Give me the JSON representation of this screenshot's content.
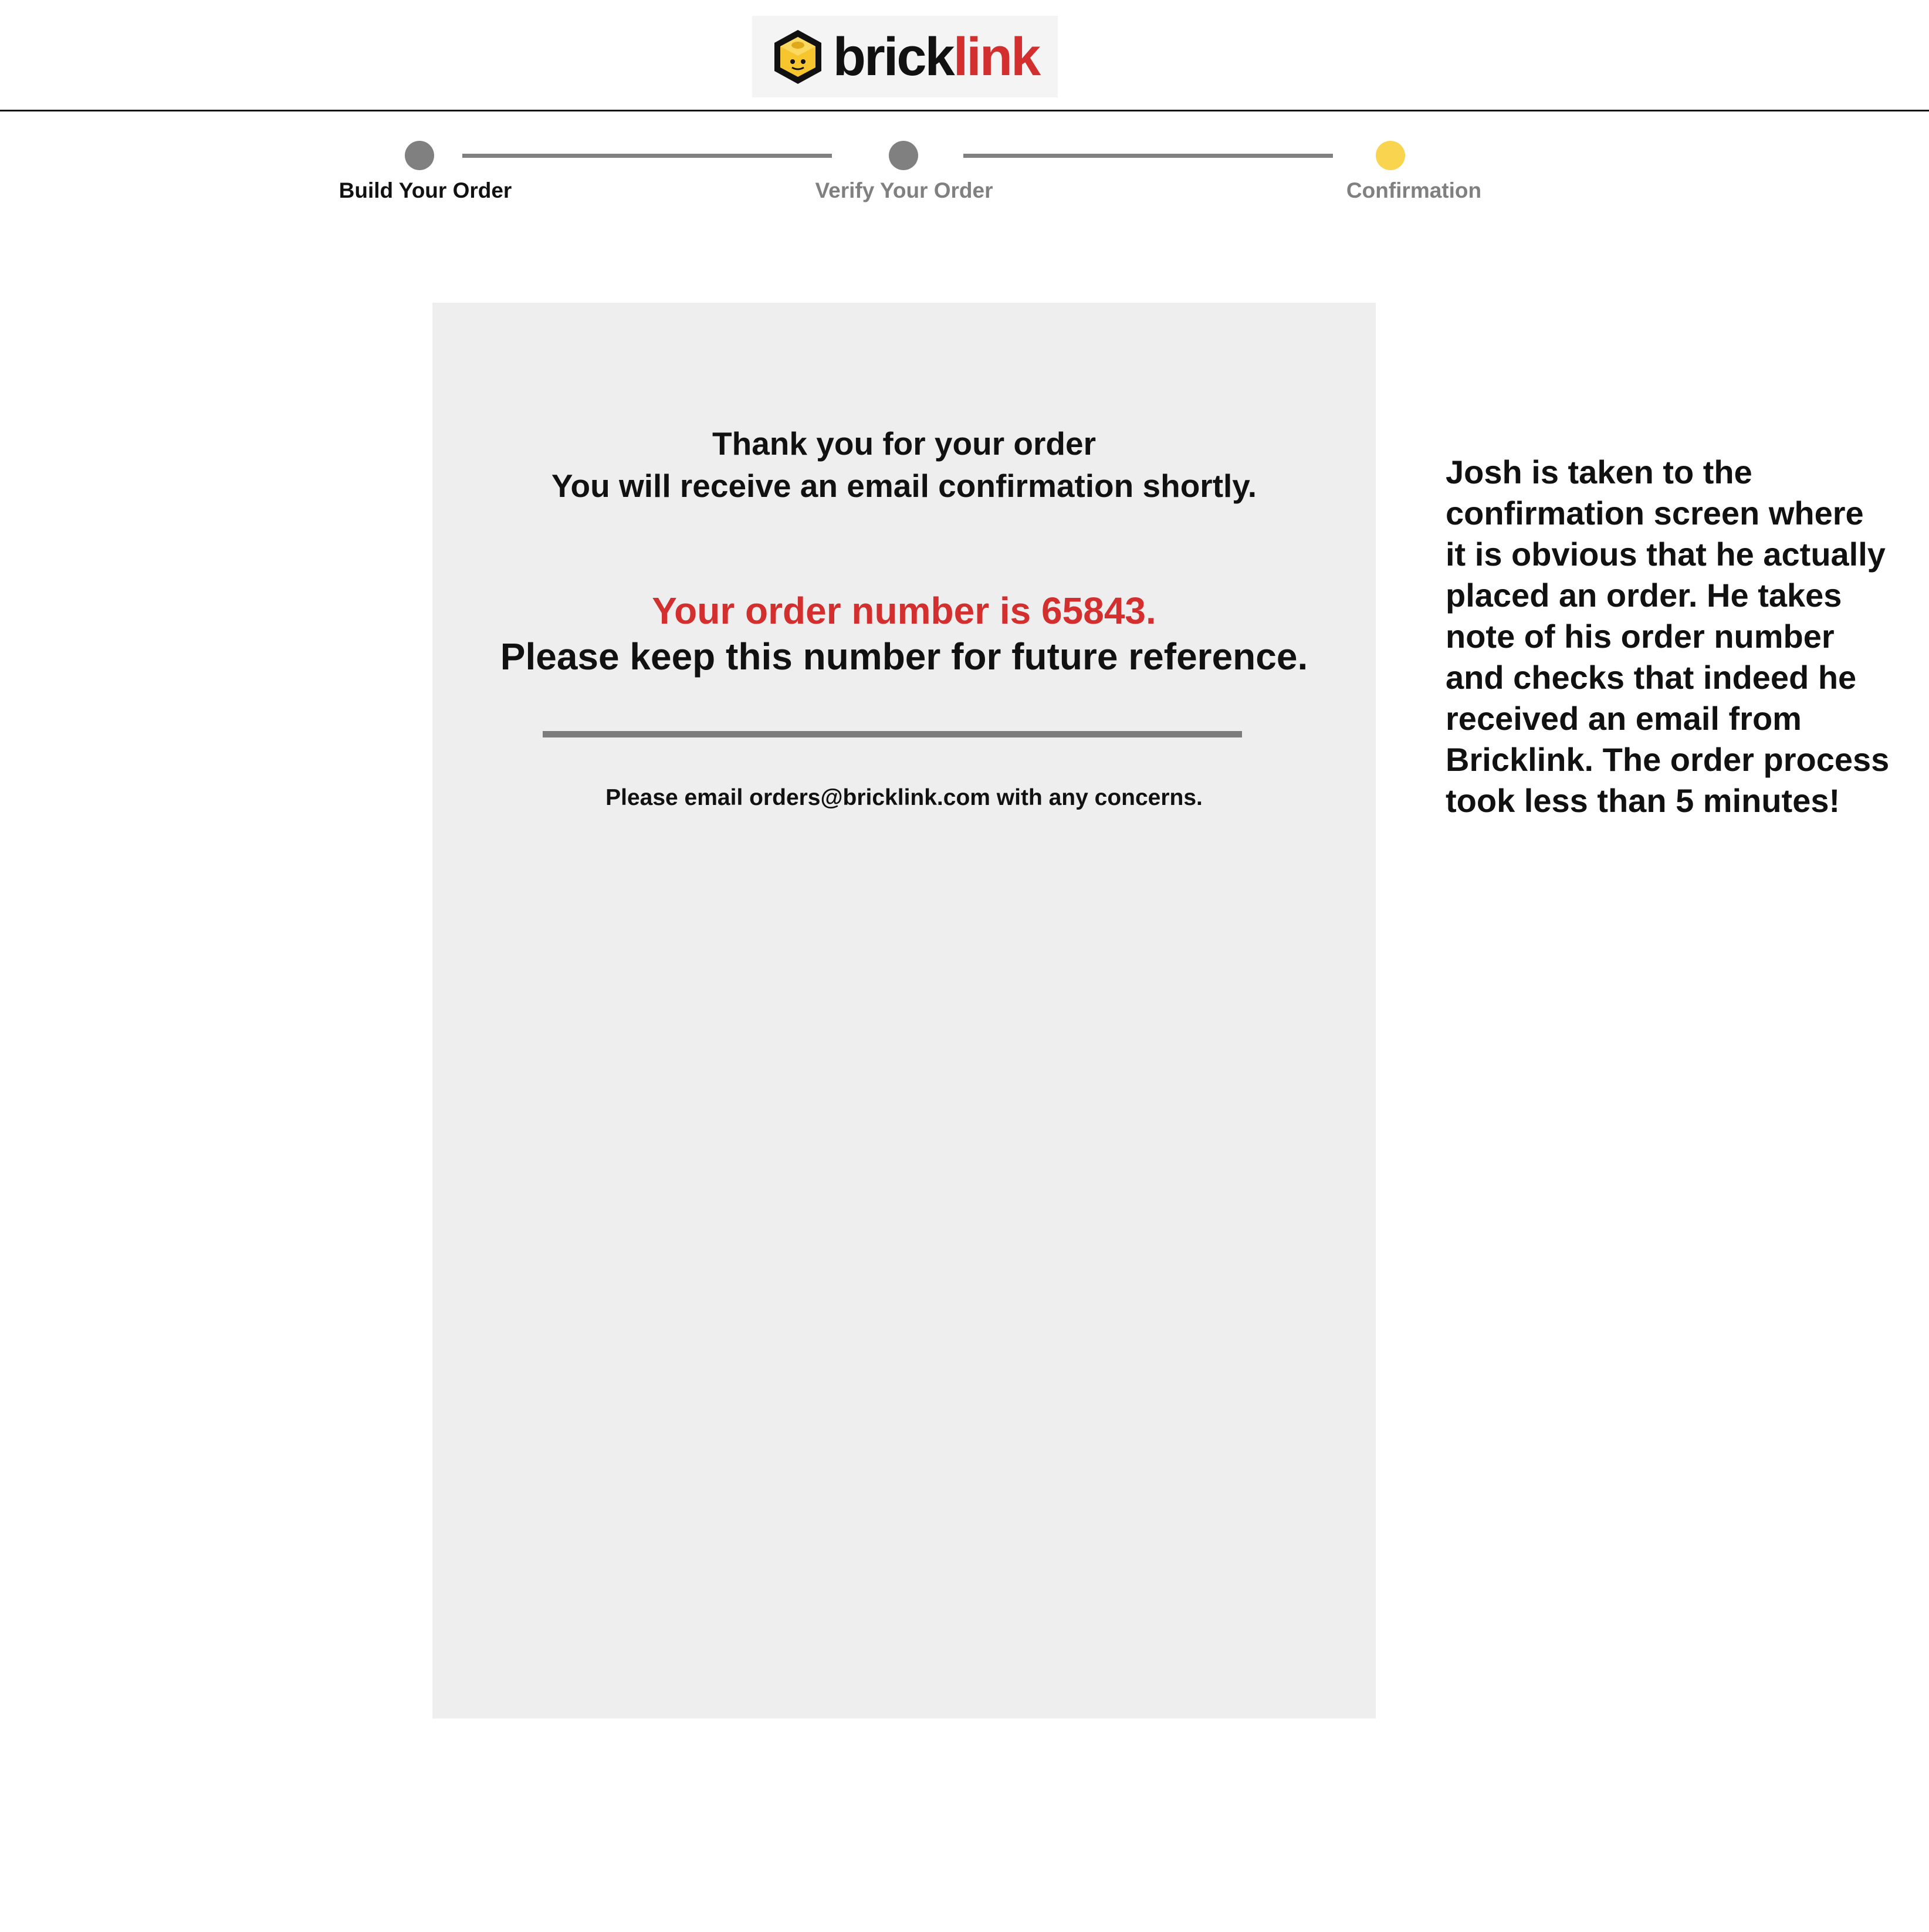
{
  "header": {
    "logo": {
      "wordmark_part1": "brick",
      "wordmark_part2": "link",
      "icon": "lego-brick-logo-icon"
    }
  },
  "stepper": {
    "steps": [
      {
        "label": "Build Your Order",
        "state": "completed",
        "dot_color": "#808080",
        "label_color": "#111111"
      },
      {
        "label": "Verify Your Order",
        "state": "completed",
        "dot_color": "#808080",
        "label_color": "#808080"
      },
      {
        "label": "Confirmation",
        "state": "current",
        "dot_color": "#f9d44f",
        "label_color": "#808080"
      }
    ]
  },
  "confirmation": {
    "title": "Thank you for your order",
    "subtitle": "You will receive an email confirmation shortly.",
    "order_number_text": "Your order number is 65843.",
    "keep_reference_text": "Please keep this number for future reference.",
    "concerns_text": "Please email orders@bricklink.com with any concerns."
  },
  "annotation": {
    "text": "Josh is taken to the confirmation screen where it is obvious that he actually placed an order. He takes note of his order number and checks that indeed he received an email from Bricklink. The order process took less than 5 minutes!"
  },
  "colors": {
    "accent_red": "#d32f2f",
    "current_step_yellow": "#f9d44f",
    "inactive_gray": "#808080",
    "panel_background": "#eeeeee"
  }
}
